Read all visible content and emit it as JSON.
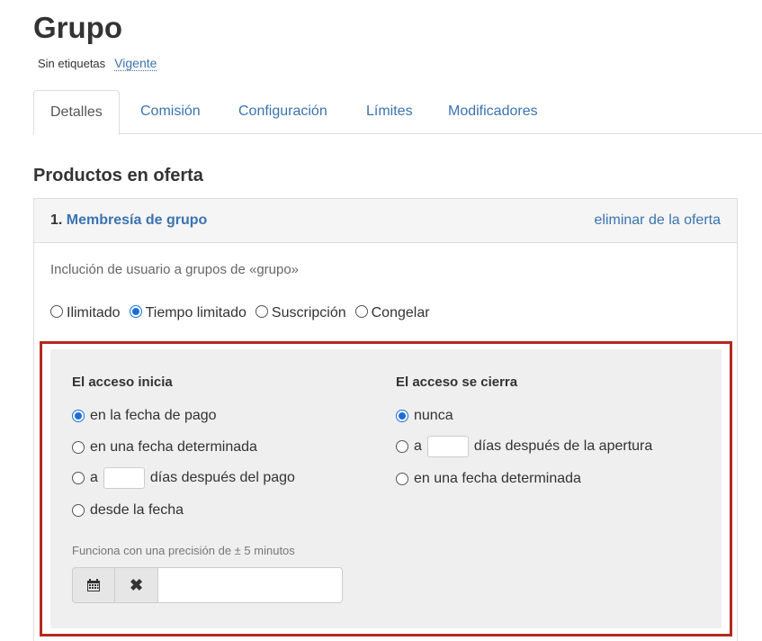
{
  "page": {
    "title": "Grupo",
    "tag_none": "Sin etiquetas",
    "status_link": "Vigente"
  },
  "tabs": [
    {
      "label": "Detalles",
      "active": true
    },
    {
      "label": "Comisión",
      "active": false
    },
    {
      "label": "Configuración",
      "active": false
    },
    {
      "label": "Límites",
      "active": false
    },
    {
      "label": "Modificadores",
      "active": false
    }
  ],
  "section": {
    "title": "Productos en oferta"
  },
  "offer": {
    "number": "1.",
    "name": "Membresía de grupo",
    "remove_label": "eliminar de la oferta",
    "description": "Inclución de usuario a grupos de «grupo»",
    "types": [
      {
        "label": "Ilimitado",
        "checked": false
      },
      {
        "label": "Tiempo limitado",
        "checked": true
      },
      {
        "label": "Suscripción",
        "checked": false
      },
      {
        "label": "Congelar",
        "checked": false
      }
    ],
    "access_start": {
      "title": "El acceso inicia",
      "on_payment": "en la fecha de pago",
      "on_date": "en una fecha determinada",
      "after_prefix": "a",
      "after_suffix": "días después del pago",
      "from_date": "desde la fecha",
      "selected": "on_payment",
      "hint": "Funciona con una precisión de ± 5 minutos",
      "date_value": ""
    },
    "access_end": {
      "title": "El acceso se cierra",
      "never": "nunca",
      "after_prefix": "a",
      "after_suffix": "días después de la apertura",
      "on_date": "en una fecha determinada",
      "selected": "never"
    }
  },
  "colors": {
    "link": "#3b73b0",
    "highlight_border": "#b32a1c",
    "radio_checked": "#1a6fd6"
  }
}
